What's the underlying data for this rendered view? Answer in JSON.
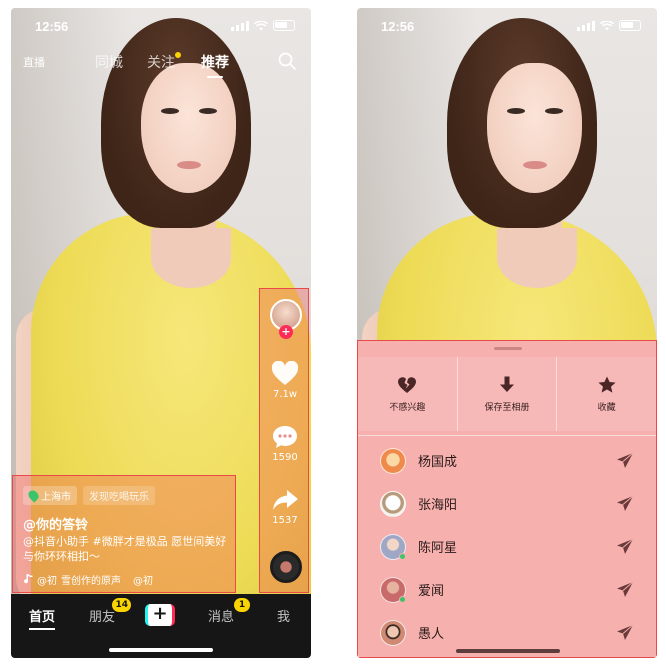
{
  "left_screen": {
    "status": {
      "time": "12:56"
    },
    "top_nav": {
      "live_label": "直播",
      "tabs": [
        {
          "label": "同城"
        },
        {
          "label": "关注"
        },
        {
          "label": "推荐"
        }
      ]
    },
    "side_actions": {
      "likes": "7.1w",
      "comments": "1590",
      "shares": "1537"
    },
    "caption": {
      "location": "上海市",
      "location_sub": "发现吃喝玩乐",
      "author": "@你的答铃",
      "description": "@抖音小助手 #微胖才是极品 愿世间美好与你环环相扣～",
      "music_prefix": "@初",
      "music_title": "雪创作的原声",
      "music_suffix": "@初"
    },
    "bottom_nav": {
      "home": "首页",
      "friends": "朋友",
      "friends_badge": "14",
      "create": "+",
      "messages": "消息",
      "messages_badge": "1",
      "me": "我"
    }
  },
  "right_screen": {
    "status": {
      "time": "12:56"
    },
    "quick_actions": [
      {
        "label": "不感兴趣",
        "icon": "broken-heart-icon"
      },
      {
        "label": "保存至相册",
        "icon": "download-icon"
      },
      {
        "label": "收藏",
        "icon": "star-icon"
      }
    ],
    "contacts": [
      {
        "name": "杨国成",
        "online": false,
        "avatar_color": "#f08a4a"
      },
      {
        "name": "张海阳",
        "online": false,
        "avatar_color": "#f3efe9"
      },
      {
        "name": "陈阿星",
        "online": true,
        "avatar_color": "#9fa7c7"
      },
      {
        "name": "爱闻",
        "online": true,
        "avatar_color": "#c96a6a"
      },
      {
        "name": "愚人",
        "online": false,
        "avatar_color": "#d08a73"
      }
    ]
  },
  "colors": {
    "highlight_fill": "#f05050",
    "badge_yellow": "#f9d400",
    "tiktok_red": "#fe2c55",
    "tiktok_cyan": "#25f4ee",
    "online_green": "#3bc46a"
  }
}
